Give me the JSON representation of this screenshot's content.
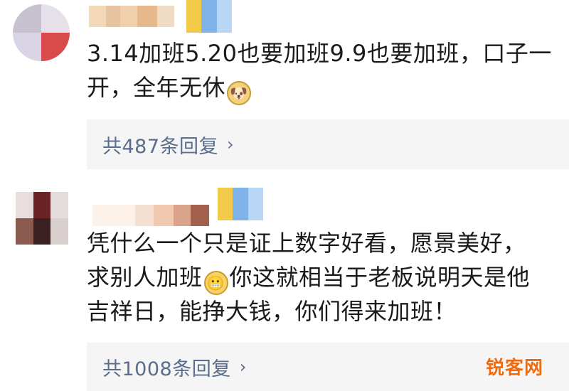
{
  "comments": [
    {
      "text_line_1": "3.14加班5.20也要加班9.9也要加班，口子一",
      "text_line_2": "开，全年无休",
      "emoji_icon": "doge-icon",
      "replies_label": "共487条回复"
    },
    {
      "text_line_1": "凭什么一个只是证上数字好看，愿景美好，",
      "text_line_2_a": "求别人加班",
      "emoji_icon": "grin-icon",
      "text_line_2_b": "你这就相当于老板说明天是他",
      "text_line_3": "吉祥日，能挣大钱，你们得来加班！",
      "replies_label": "共1008条回复"
    }
  ],
  "watermark": {
    "text": "锐客网"
  },
  "colors": {
    "reply_link": "#5a6d8c",
    "reply_bg": "#f5f5f5",
    "watermark": "#f06a0f"
  },
  "icons": {
    "chevron": "chevron-right-icon"
  }
}
